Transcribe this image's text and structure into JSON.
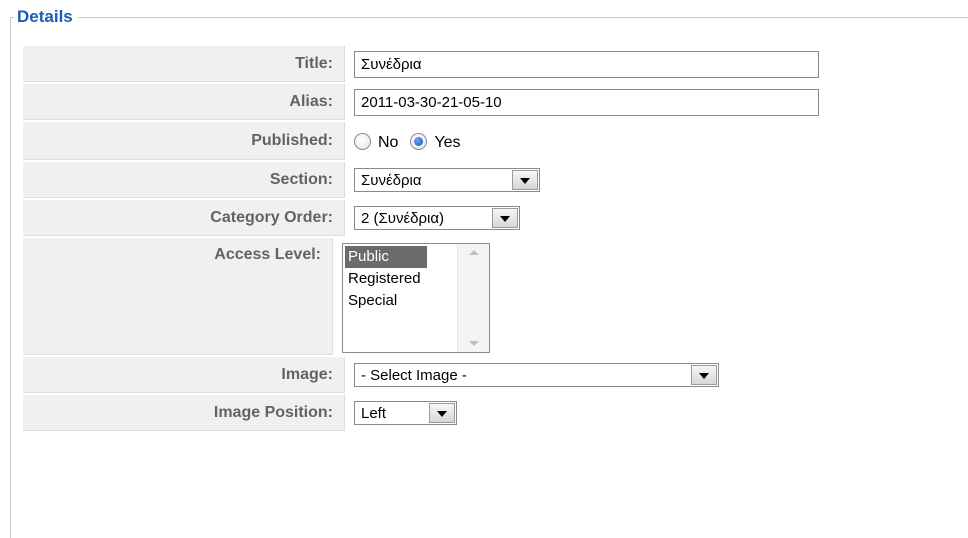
{
  "fieldset": {
    "legend": "Details"
  },
  "fields": {
    "title": {
      "label": "Title:",
      "value": "Συνέδρια"
    },
    "alias": {
      "label": "Alias:",
      "value": "2011-03-30-21-05-10"
    },
    "published": {
      "label": "Published:",
      "options": [
        "No",
        "Yes"
      ],
      "selected": "Yes"
    },
    "section": {
      "label": "Section:",
      "value": "Συνέδρια"
    },
    "category_order": {
      "label": "Category Order:",
      "value": "2 (Συνέδρια)"
    },
    "access_level": {
      "label": "Access Level:",
      "options": [
        "Public",
        "Registered",
        "Special"
      ],
      "selected": "Public"
    },
    "image": {
      "label": "Image:",
      "value": "- Select Image -"
    },
    "image_position": {
      "label": "Image Position:",
      "value": "Left"
    }
  },
  "colors": {
    "legend": "#1a5bbf",
    "label_bg": "#f0f0f0",
    "label_text": "#636363",
    "selected_bg": "#6b6b6b"
  }
}
